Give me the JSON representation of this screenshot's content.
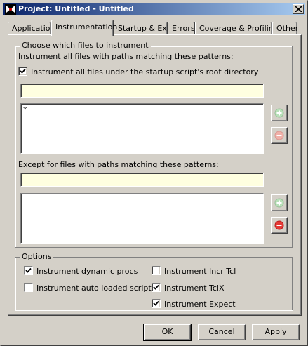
{
  "window": {
    "title": "Project: Untitled - Untitled"
  },
  "tabs": [
    {
      "label": "Application"
    },
    {
      "label": "Instrumentation"
    },
    {
      "label": "Startup & Exit"
    },
    {
      "label": "Errors"
    },
    {
      "label": "Coverage & Profiling"
    },
    {
      "label": "Other"
    }
  ],
  "active_tab": "Instrumentation",
  "files_group": {
    "title": "Choose which files to instrument",
    "include_label": "Instrument all files with paths matching these patterns:",
    "root_dir_checkbox": {
      "label": "Instrument all files under the startup script's root directory",
      "checked": true
    },
    "include_input_value": "",
    "include_patterns": [
      "*"
    ],
    "exclude_label": "Except for files with paths matching these patterns:",
    "exclude_input_value": "",
    "exclude_patterns": []
  },
  "options_group": {
    "title": "Options",
    "dynamic_procs": {
      "label": "Instrument dynamic procs",
      "checked": true
    },
    "auto_loaded": {
      "label": "Instrument auto loaded scripts",
      "checked": false
    },
    "incr_tcl": {
      "label": "Instrument Incr Tcl",
      "checked": false
    },
    "tclx": {
      "label": "Instrument TclX",
      "checked": true
    },
    "expect": {
      "label": "Instrument Expect",
      "checked": true
    }
  },
  "buttons": {
    "ok": "OK",
    "cancel": "Cancel",
    "apply": "Apply"
  },
  "colors": {
    "titlebar_start": "#0a246a",
    "titlebar_end": "#a6caf0",
    "input_bg": "#ffffe0",
    "add_green": "#4caf50",
    "remove_red": "#e53935"
  }
}
